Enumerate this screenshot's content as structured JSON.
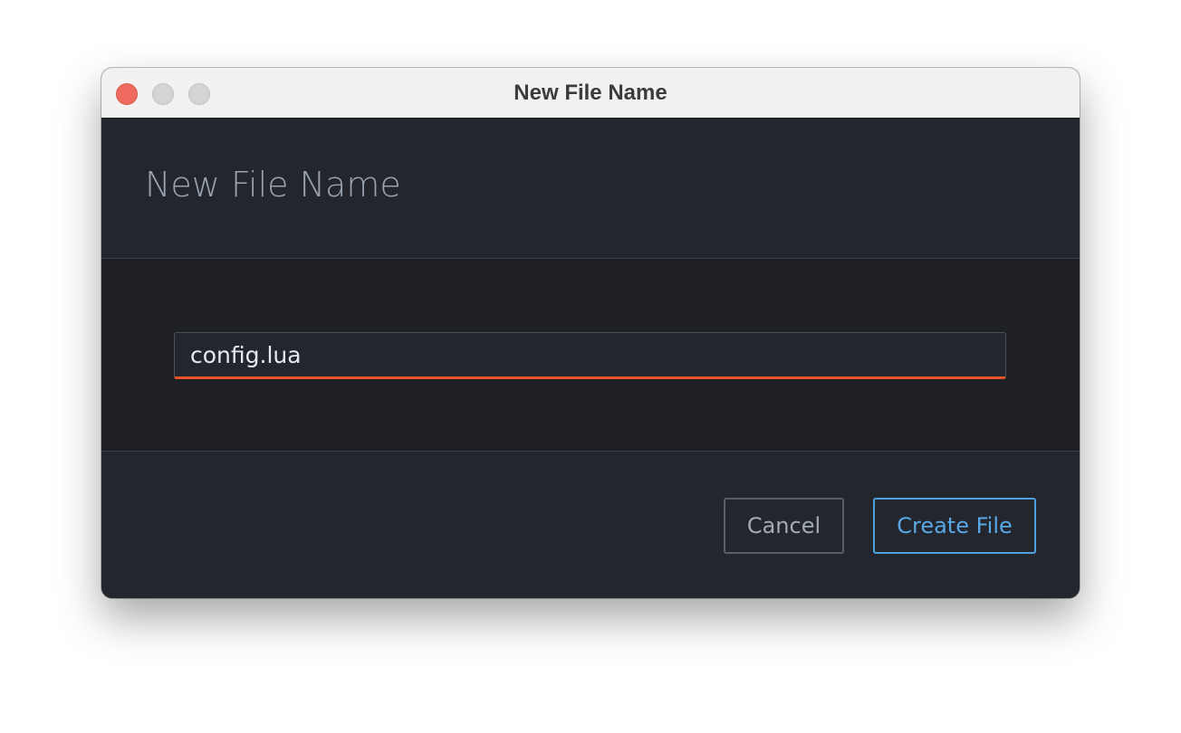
{
  "window": {
    "title": "New File Name"
  },
  "dialog": {
    "heading": "New File Name",
    "input": {
      "value": "config.lua"
    },
    "buttons": {
      "cancel_label": "Cancel",
      "create_label": "Create File"
    }
  },
  "colors": {
    "accent_underline": "#e8552a",
    "primary_button": "#4ea0df",
    "close_button": "#ee6a5f"
  }
}
